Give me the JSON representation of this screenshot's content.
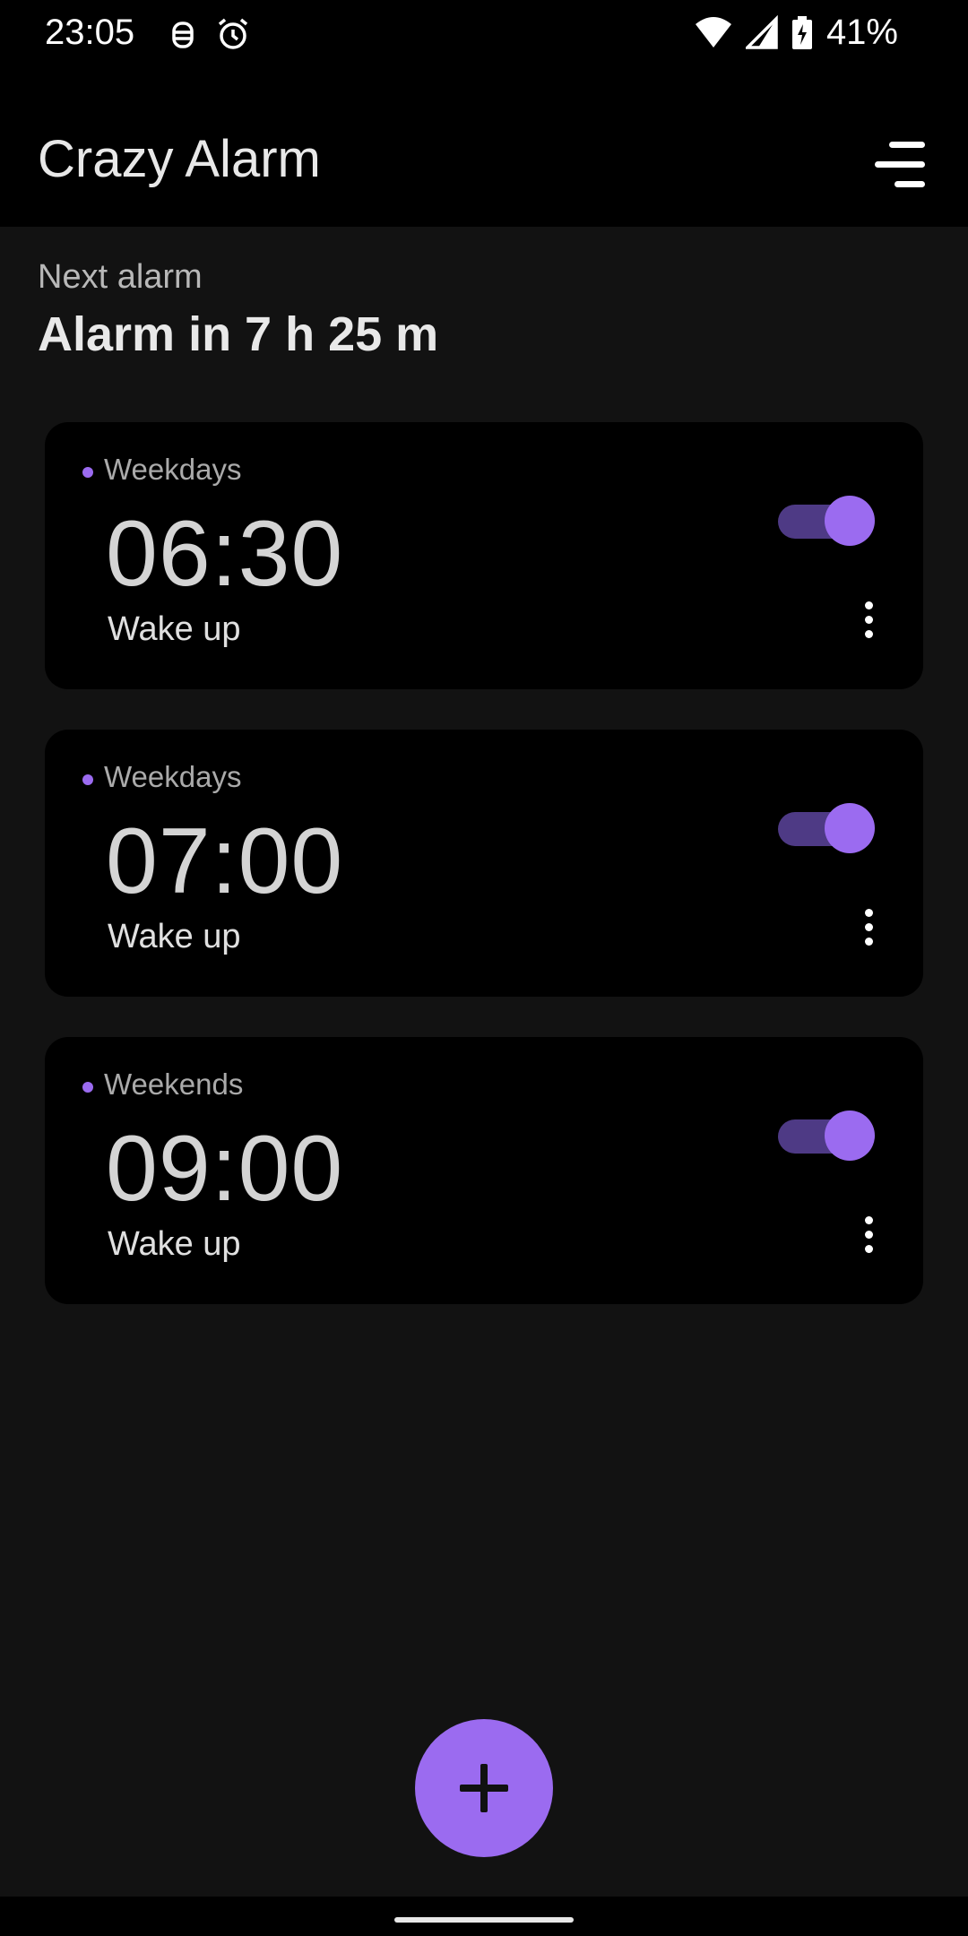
{
  "status_bar": {
    "time": "23:05",
    "battery_percent": "41%",
    "icons": [
      "bug-icon",
      "alarm-clock-icon",
      "wifi-icon",
      "cell-signal-icon",
      "battery-charging-icon"
    ]
  },
  "app_bar": {
    "title": "Crazy Alarm",
    "menu_icon": "sort-menu-icon"
  },
  "next_alarm": {
    "label": "Next alarm",
    "value": "Alarm in 7 h 25 m"
  },
  "alarms": [
    {
      "days": "Weekdays",
      "time": "06:30",
      "label": "Wake up",
      "enabled": true
    },
    {
      "days": "Weekdays",
      "time": "07:00",
      "label": "Wake up",
      "enabled": true
    },
    {
      "days": "Weekends",
      "time": "09:00",
      "label": "Wake up",
      "enabled": true
    }
  ],
  "fab": {
    "icon": "plus-icon"
  },
  "colors": {
    "accent": "#9b6bf0",
    "toggle_track": "#4e3a85",
    "background": "#121212",
    "card": "#000000"
  }
}
